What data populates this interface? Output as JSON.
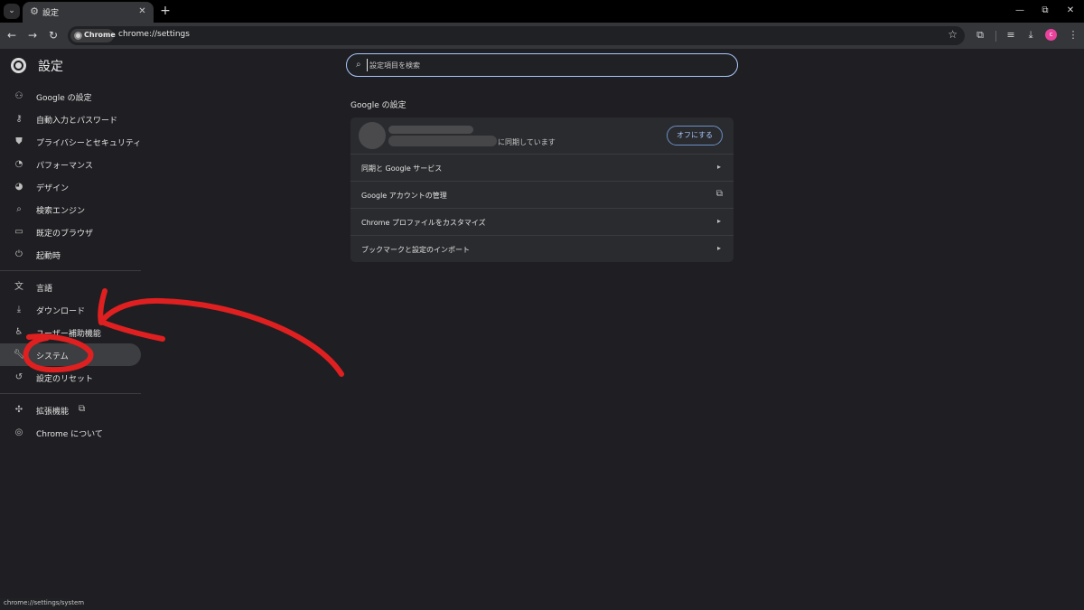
{
  "tab": {
    "title": "設定",
    "icon": "gear-icon"
  },
  "toolbar": {
    "chip_label": "Chrome",
    "url": "chrome://settings",
    "avatar_letter": "c",
    "avatar_color": "#e8439c"
  },
  "sidebar": {
    "title": "設定",
    "items": [
      {
        "label": "Google の設定",
        "icon": "person-icon"
      },
      {
        "label": "自動入力とパスワード",
        "icon": "key-icon"
      },
      {
        "label": "プライバシーとセキュリティ",
        "icon": "shield-icon"
      },
      {
        "label": "パフォーマンス",
        "icon": "speedometer-icon"
      },
      {
        "label": "デザイン",
        "icon": "palette-icon"
      },
      {
        "label": "検索エンジン",
        "icon": "search-icon"
      },
      {
        "label": "既定のブラウザ",
        "icon": "browser-icon"
      },
      {
        "label": "起動時",
        "icon": "power-icon"
      },
      {
        "label": "言語",
        "icon": "translate-icon"
      },
      {
        "label": "ダウンロード",
        "icon": "download-icon"
      },
      {
        "label": "ユーザー補助機能",
        "icon": "accessibility-icon"
      },
      {
        "label": "システム",
        "icon": "wrench-icon",
        "selected": true
      },
      {
        "label": "設定のリセット",
        "icon": "reset-icon"
      },
      {
        "label": "拡張機能",
        "icon": "puzzle-icon"
      },
      {
        "label": "Chrome について",
        "icon": "chrome-icon"
      }
    ]
  },
  "search": {
    "placeholder": "設定項目を検索",
    "value": ""
  },
  "main": {
    "section_title": "Google の設定",
    "account": {
      "sync_text": "に同期しています",
      "off_button": "オフにする"
    },
    "rows": [
      {
        "label": "同期と Google サービス",
        "icon": "chevron-right-icon"
      },
      {
        "label": "Google アカウントの管理",
        "icon": "external-link-icon"
      },
      {
        "label": "Chrome プロファイルをカスタマイズ",
        "icon": "chevron-right-icon"
      },
      {
        "label": "ブックマークと設定のインポート",
        "icon": "chevron-right-icon"
      }
    ]
  },
  "status_bar": {
    "text": "chrome://settings/system"
  },
  "accent_colors": {
    "focus_ring": "#a8c7fa",
    "annotation": "#e02020"
  }
}
